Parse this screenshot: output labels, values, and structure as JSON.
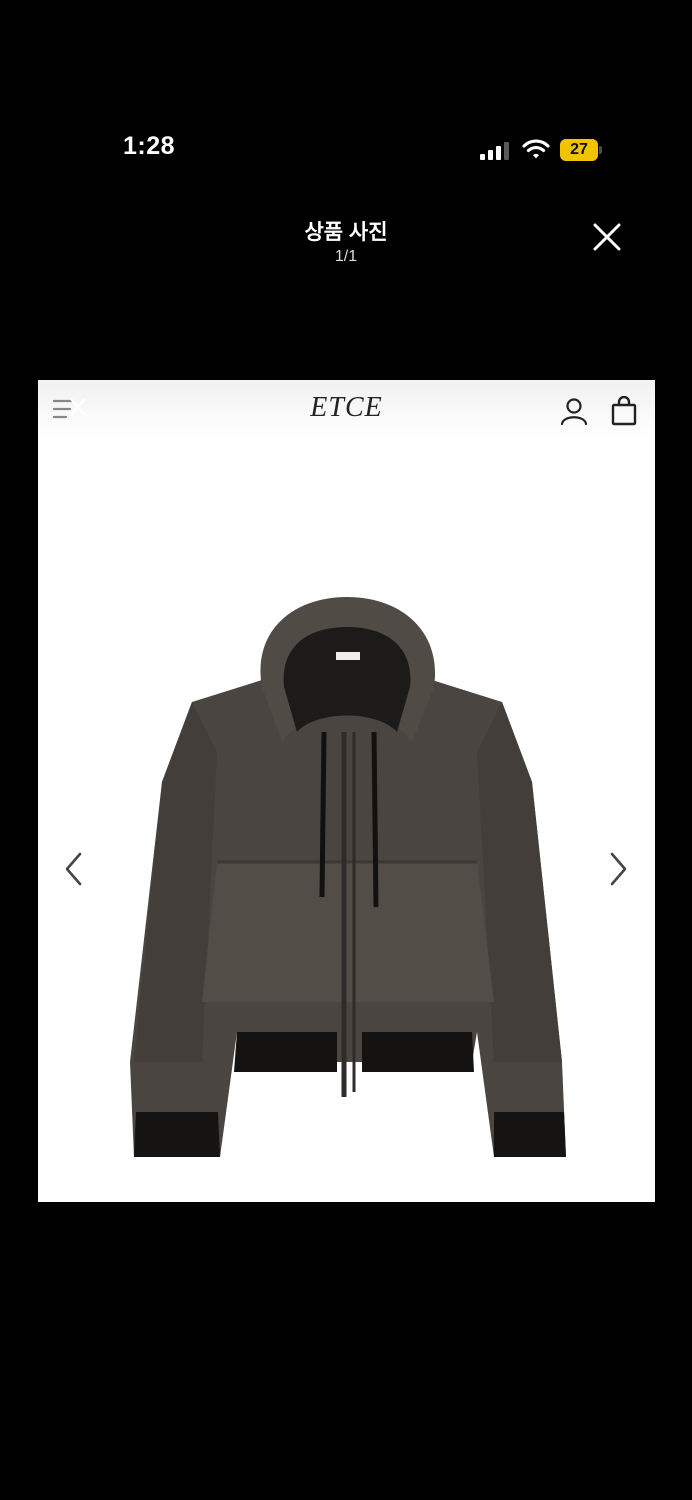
{
  "status_bar": {
    "time": "1:28",
    "battery_level": "27",
    "battery_color": "#f2c400",
    "icons": [
      "signal-icon",
      "wifi-icon",
      "battery-icon"
    ]
  },
  "viewer": {
    "title": "상품 사진",
    "counter": "1/1",
    "close_icon": "close-icon"
  },
  "photo": {
    "brand": "ETCE",
    "header_icons": [
      "menu-icon",
      "user-icon",
      "shopping-bag-icon"
    ],
    "nav_icons": [
      "chevron-left-icon",
      "chevron-right-icon"
    ],
    "product_image": "hooded-zip-jacket"
  }
}
